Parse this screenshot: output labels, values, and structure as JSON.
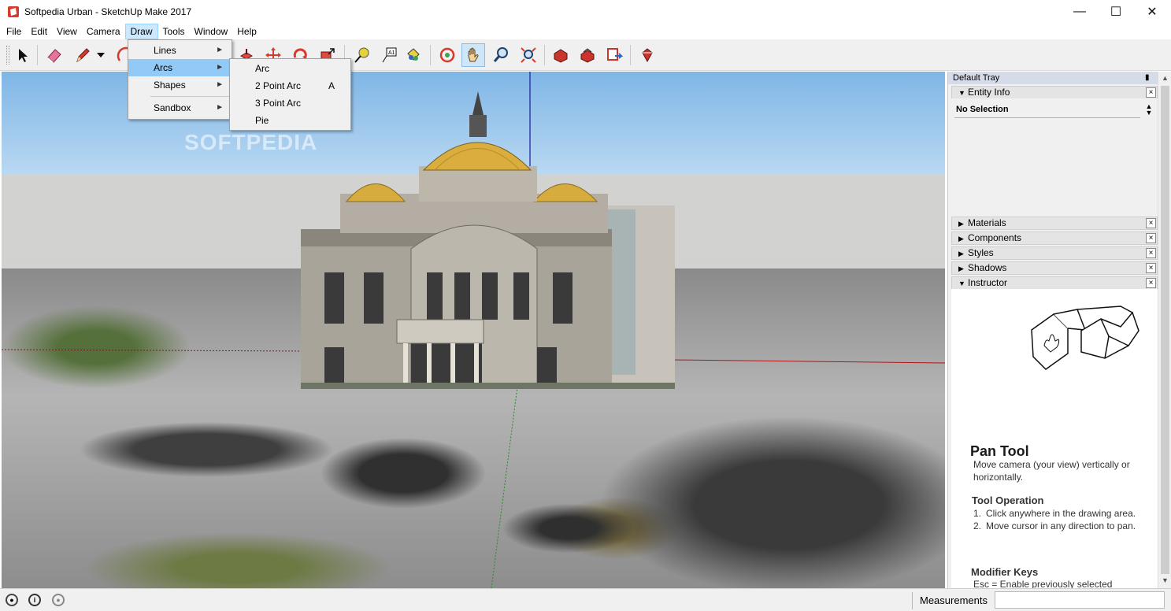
{
  "window": {
    "title": "Softpedia Urban - SketchUp Make 2017",
    "minimize": "—",
    "maximize": "☐",
    "close": "✕"
  },
  "menubar": {
    "items": [
      "File",
      "Edit",
      "View",
      "Camera",
      "Draw",
      "Tools",
      "Window",
      "Help"
    ],
    "active": "Draw"
  },
  "draw_menu": {
    "items": [
      {
        "label": "Lines",
        "submenu": true
      },
      {
        "label": "Arcs",
        "submenu": true,
        "highlighted": true
      },
      {
        "label": "Shapes",
        "submenu": true
      },
      {
        "label": "Sandbox",
        "submenu": true
      }
    ]
  },
  "arcs_submenu": {
    "items": [
      {
        "label": "Arc",
        "accel": ""
      },
      {
        "label": "2 Point Arc",
        "accel": "A"
      },
      {
        "label": "3 Point Arc",
        "accel": ""
      },
      {
        "label": "Pie",
        "accel": ""
      }
    ]
  },
  "toolbar": {
    "tools": [
      "select-icon",
      "eraser-icon",
      "pencil-icon",
      "dropdown-icon",
      "arc-icon",
      "push-pull-icon",
      "move-icon",
      "rotate-icon",
      "scale-icon",
      "tape-measure-icon",
      "text-icon",
      "paint-bucket-icon",
      "orbit-icon",
      "pan-icon",
      "zoom-icon",
      "zoom-extents-icon",
      "warehouse-icon",
      "share-model-icon",
      "extension-icon",
      "ruby-icon"
    ],
    "pressed": "pan-icon"
  },
  "watermark": "SOFTPEDIA",
  "tray": {
    "title": "Default Tray",
    "pin": "📌",
    "close": "x",
    "entity_info": {
      "label": "Entity Info",
      "status": "No Selection"
    },
    "panels": [
      "Materials",
      "Components",
      "Styles",
      "Shadows",
      "Instructor"
    ],
    "instructor": {
      "title": "Pan Tool",
      "description": "Move camera (your view) vertically or horizontally.",
      "operation_heading": "Tool Operation",
      "steps": [
        {
          "num": "1.",
          "text": "Click anywhere in the drawing area."
        },
        {
          "num": "2.",
          "text": "Move cursor in any direction to pan."
        }
      ],
      "modifier_heading": "Modifier Keys",
      "modifier_text": "Esc = Enable previously selected"
    }
  },
  "statusbar": {
    "measurements_label": "Measurements",
    "measurements_value": ""
  },
  "colors": {
    "menu_highlight": "#91c9f7",
    "tray_header": "#d6dbe9",
    "pressed_tool": "#cfe6f9"
  }
}
